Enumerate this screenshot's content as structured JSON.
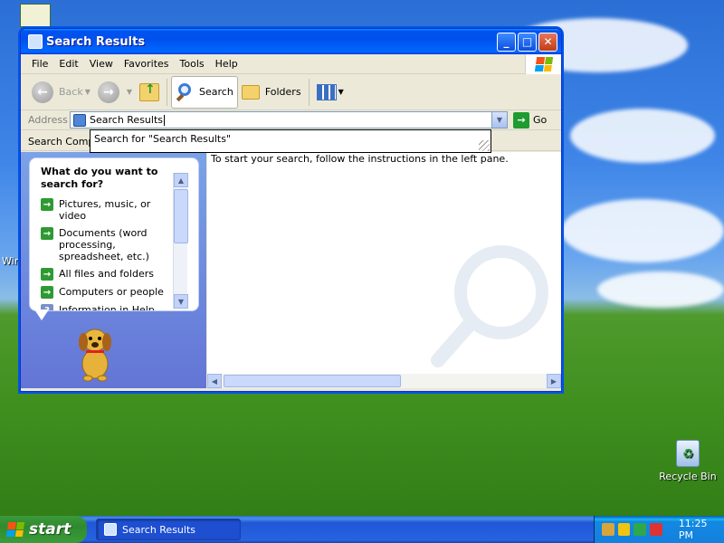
{
  "window": {
    "title": "Search Results",
    "controls": {
      "minimize": "_",
      "maximize": "□",
      "close": "✕"
    }
  },
  "menu": [
    "File",
    "Edit",
    "View",
    "Favorites",
    "Tools",
    "Help"
  ],
  "toolbar": {
    "back": "Back",
    "search": "Search",
    "folders": "Folders"
  },
  "address": {
    "label": "Address",
    "value": "Search Results",
    "go": "Go",
    "suggestion": "Search for \"Search Results\""
  },
  "columns": {
    "first": "Search Compa"
  },
  "assistant": {
    "question": "What do you want to search for?",
    "options": [
      "Pictures, music, or video",
      "Documents (word processing, spreadsheet, etc.)",
      "All files and folders",
      "Computers or people",
      "Information in Help and"
    ]
  },
  "results": {
    "message": "To start your search, follow the instructions in the left pane."
  },
  "desktop": {
    "recycle_bin": "Recycle Bin",
    "partial_label": "Win"
  },
  "taskbar": {
    "start": "start",
    "task": "Search Results",
    "clock": "11:25 PM"
  },
  "colors": {
    "xp_blue": "#0054e3",
    "start_green": "#3c9a3a",
    "accent_arrow": "#2f9a33"
  }
}
